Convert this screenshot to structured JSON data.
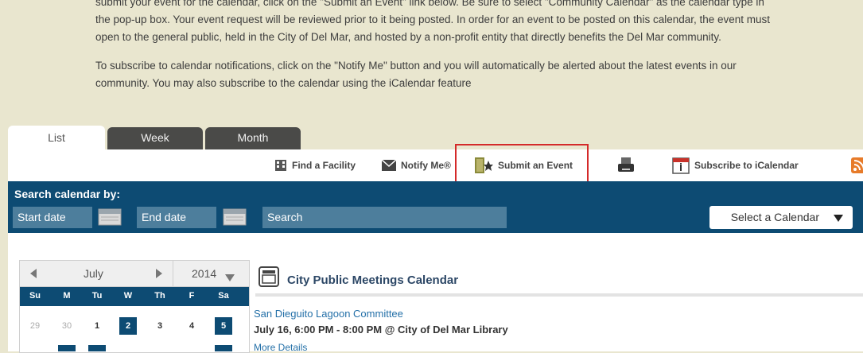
{
  "intro": {
    "p1_line1": "submit your event for the calendar, click on the \"Submit an Event\" link below. Be sure to select \"Community Calendar\" as the calendar type in",
    "p1_line2": "the pop-up box. Your event request will be reviewed prior to it being posted. In order for an event to be posted on this calendar, the event must",
    "p1_line3": "open to the general public, held in the City of Del Mar, and hosted by a non-profit entity that directly benefits the Del Mar community.",
    "p2_line1": "To subscribe to calendar notifications, click on the \"Notify Me\" button and you will automatically be alerted about the latest events in our",
    "p2_line2": "community. You may also subscribe to the calendar using the iCalendar feature"
  },
  "tabs": [
    {
      "label": "List",
      "active": true
    },
    {
      "label": "Week",
      "active": false
    },
    {
      "label": "Month",
      "active": false
    }
  ],
  "toolbar": {
    "find_facility": "Find a Facility",
    "notify_me": "Notify Me®",
    "submit_event": "Submit an Event",
    "subscribe_ical": "Subscribe to iCalendar"
  },
  "search": {
    "title": "Search calendar by:",
    "start_date": "Start date",
    "end_date": "End date",
    "search_placeholder": "Search",
    "select_calendar": "Select a Calendar"
  },
  "mini_calendar": {
    "month": "July",
    "year": "2014",
    "days_of_week": [
      "Su",
      "M",
      "Tu",
      "W",
      "Th",
      "F",
      "Sa"
    ],
    "first_week": [
      "29",
      "30",
      "1",
      "2",
      "3",
      "4",
      "5"
    ]
  },
  "meetings": {
    "calendar_title": "City Public Meetings Calendar",
    "event_name": "San Dieguito Lagoon Committee",
    "event_time": "July 16, 6:00 PM - 8:00 PM @ City of Del Mar Library",
    "more_details": "More Details"
  },
  "colors": {
    "navy": "#0d4b73",
    "highlight_red": "#d42a2a",
    "page_bg": "#e9e6cf"
  }
}
